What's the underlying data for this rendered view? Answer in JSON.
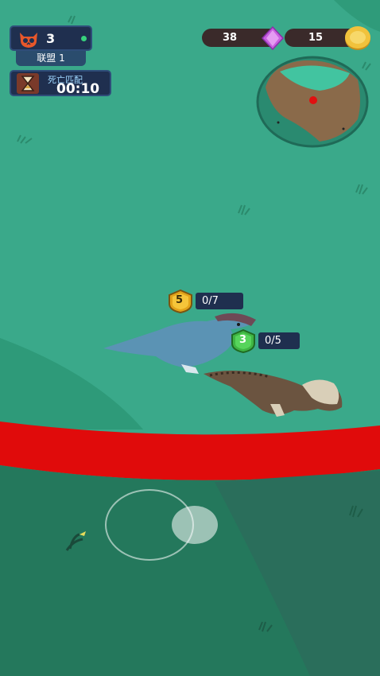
{
  "hud": {
    "kills": "3",
    "alliance": "联盟 1",
    "mode": "死亡匹配",
    "timer": "00:10"
  },
  "currency": {
    "gems": "38",
    "coins": "15"
  },
  "players": [
    {
      "level": "5",
      "progress": "0/7",
      "badge_color": "#e2a31a"
    },
    {
      "level": "3",
      "progress": "0/5",
      "badge_color": "#3fb543"
    }
  ],
  "colors": {
    "grass": "#3aa98a",
    "danger_zone": "#e00b0b",
    "outer_field": "#24785c"
  }
}
